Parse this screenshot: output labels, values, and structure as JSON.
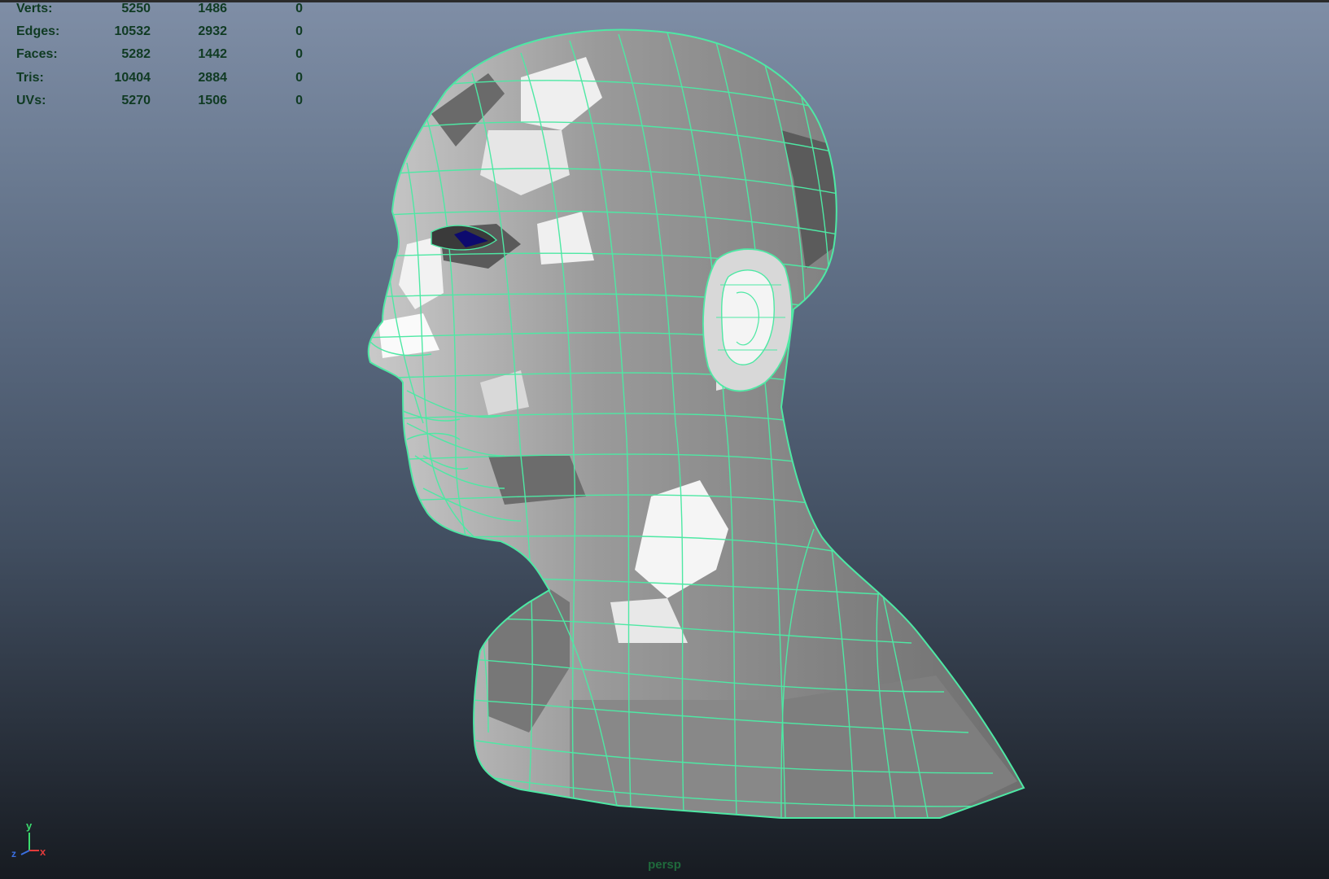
{
  "hud": {
    "rows": [
      {
        "label": "Verts:",
        "v1": "5250",
        "v2": "1486",
        "v3": "0"
      },
      {
        "label": "Edges:",
        "v1": "10532",
        "v2": "2932",
        "v3": "0"
      },
      {
        "label": "Faces:",
        "v1": "5282",
        "v2": "1442",
        "v3": "0"
      },
      {
        "label": "Tris:",
        "v1": "10404",
        "v2": "2884",
        "v3": "0"
      },
      {
        "label": "UVs:",
        "v1": "5270",
        "v2": "1506",
        "v3": "0"
      }
    ]
  },
  "axis": {
    "y": "y",
    "z": "z",
    "x": "x"
  },
  "camera": {
    "name": "persp"
  },
  "colors": {
    "wireframe": "#4ee8a4",
    "hud_text": "#0f3a22",
    "camera_label": "#1f6a3c"
  },
  "scene": {
    "object": "head-mesh-wireframe"
  }
}
